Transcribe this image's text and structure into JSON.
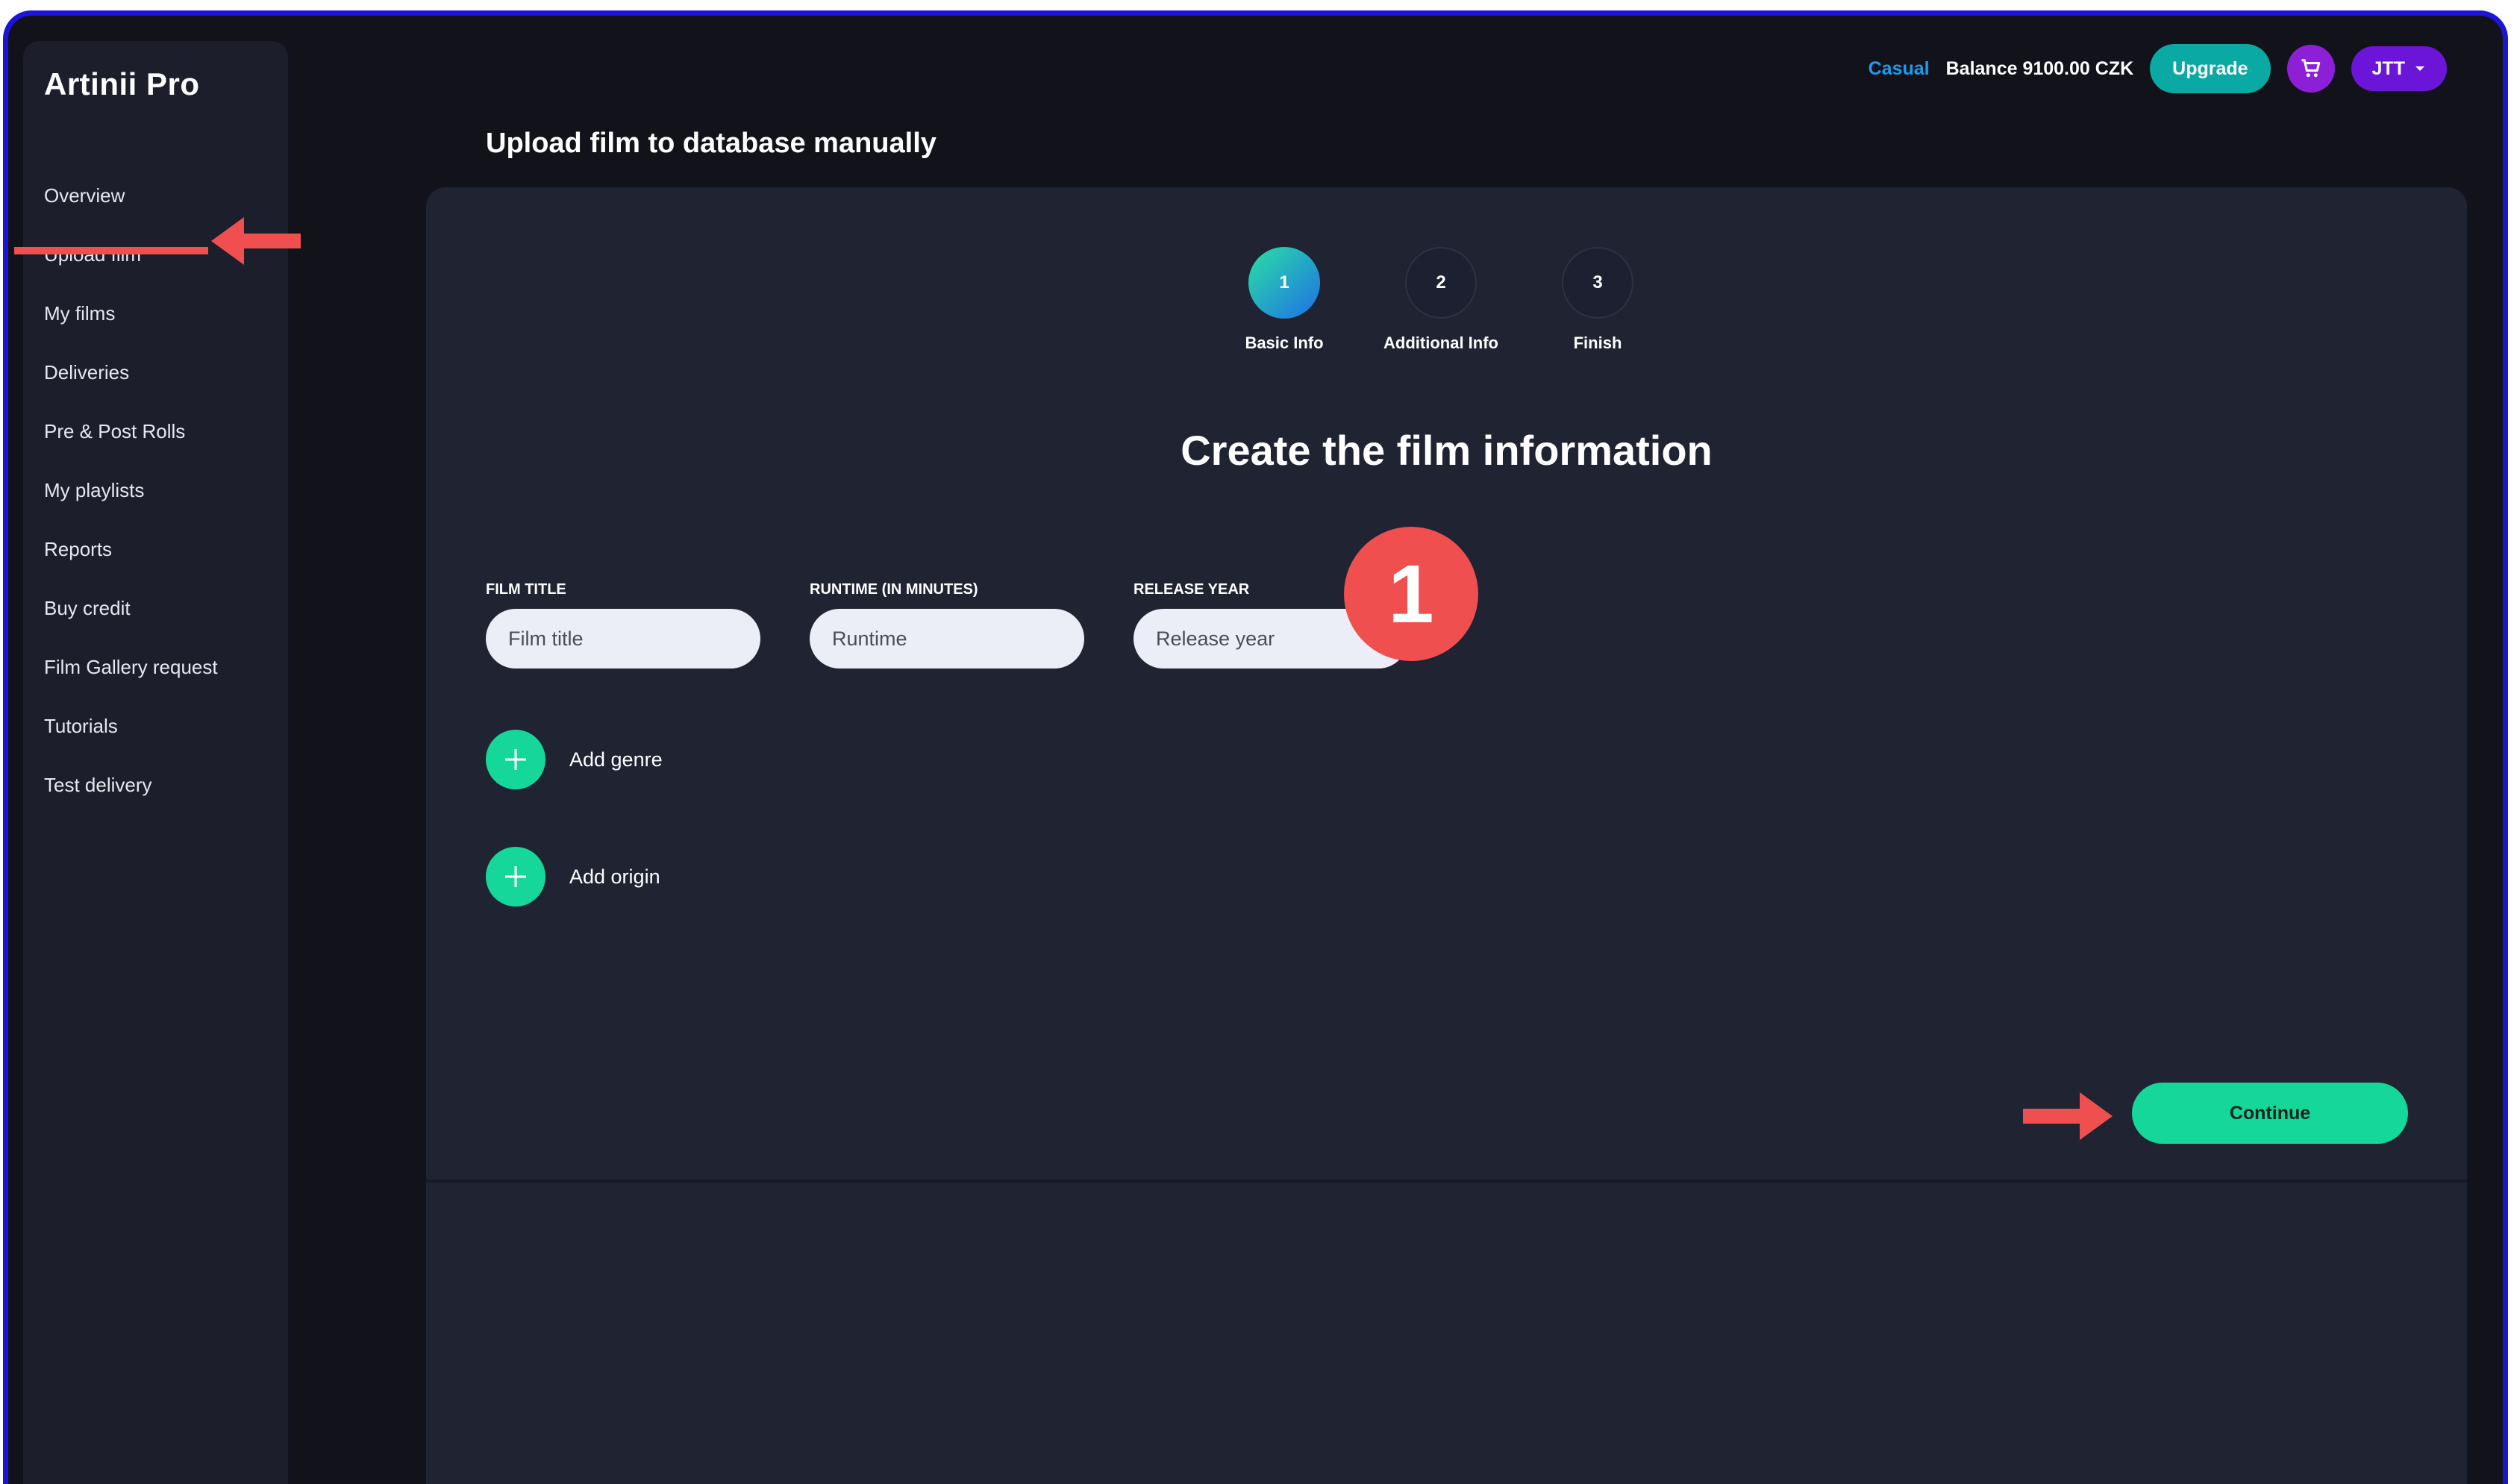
{
  "brand": "Artinii Pro",
  "page_title": "Upload film to database manually",
  "sidebar": {
    "items": [
      {
        "label": "Overview"
      },
      {
        "label": "Upload film"
      },
      {
        "label": "My films"
      },
      {
        "label": "Deliveries"
      },
      {
        "label": "Pre & Post Rolls"
      },
      {
        "label": "My playlists"
      },
      {
        "label": "Reports"
      },
      {
        "label": "Buy credit"
      },
      {
        "label": "Film Gallery request"
      },
      {
        "label": "Tutorials"
      },
      {
        "label": "Test delivery"
      }
    ]
  },
  "topbar": {
    "plan": "Casual",
    "balance": "Balance 9100.00 CZK",
    "upgrade": "Upgrade",
    "user": "JTT"
  },
  "steps": [
    {
      "number": "1",
      "label": "Basic Info"
    },
    {
      "number": "2",
      "label": "Additional Info"
    },
    {
      "number": "3",
      "label": "Finish"
    }
  ],
  "form": {
    "heading": "Create the film information",
    "fields": [
      {
        "label": "FILM TITLE",
        "placeholder": "Film title"
      },
      {
        "label": "RUNTIME (IN MINUTES)",
        "placeholder": "Runtime"
      },
      {
        "label": "RELEASE YEAR",
        "placeholder": "Release year"
      }
    ],
    "add_genre": "Add genre",
    "add_origin": "Add origin",
    "continue": "Continue"
  },
  "annotation": {
    "badge": "1"
  },
  "colors": {
    "accent_green": "#16d79a",
    "annotation_red": "#ef4f4f",
    "frame_blue": "#1d15d6",
    "upgrade_teal": "#0aa9a4",
    "user_purple": "#6b15d9"
  }
}
